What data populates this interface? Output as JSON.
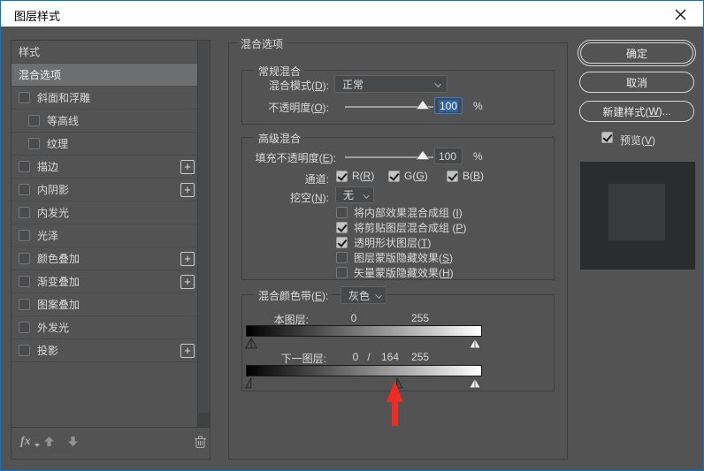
{
  "window": {
    "title": "图层样式",
    "close_glyph": "×",
    "accent_color": "#0078d7",
    "bg_color": "#535353",
    "titlebar_color": "#ffffff"
  },
  "sidebar": {
    "items": [
      {
        "label": "样式",
        "type": "plain",
        "selected": false
      },
      {
        "label": "混合选项",
        "type": "plain",
        "selected": true
      },
      {
        "label": "斜面和浮雕",
        "type": "check",
        "checked": false
      },
      {
        "label": "等高线",
        "type": "check",
        "checked": false,
        "indent": true
      },
      {
        "label": "纹理",
        "type": "check",
        "checked": false,
        "indent": true
      },
      {
        "label": "描边",
        "type": "check",
        "checked": false,
        "plus": true
      },
      {
        "label": "内阴影",
        "type": "check",
        "checked": false,
        "plus": true
      },
      {
        "label": "内发光",
        "type": "check",
        "checked": false
      },
      {
        "label": "光泽",
        "type": "check",
        "checked": false
      },
      {
        "label": "颜色叠加",
        "type": "check",
        "checked": false,
        "plus": true
      },
      {
        "label": "渐变叠加",
        "type": "check",
        "checked": false,
        "plus": true
      },
      {
        "label": "图案叠加",
        "type": "check",
        "checked": false
      },
      {
        "label": "外发光",
        "type": "check",
        "checked": false
      },
      {
        "label": "投影",
        "type": "check",
        "checked": false,
        "plus": true
      }
    ],
    "footer": {
      "fx_label": "fx"
    }
  },
  "panel": {
    "title": "混合选项",
    "general": {
      "title": "常规混合",
      "blend_mode_label": "混合模式(D):",
      "blend_mode_value": "正常",
      "opacity_label": "不透明度(O):",
      "opacity_value": "100",
      "opacity_unit": "%"
    },
    "advanced": {
      "title": "高级混合",
      "fill_label": "填充不透明度(E):",
      "fill_value": "100",
      "fill_unit": "%",
      "channels_label": "通道:",
      "channels": [
        {
          "label": "R(R)",
          "checked": true
        },
        {
          "label": "G(G)",
          "checked": true
        },
        {
          "label": "B(B)",
          "checked": true
        }
      ],
      "knockout_label": "挖空(N):",
      "knockout_value": "无",
      "options": [
        {
          "label": "将内部效果混合成组 (I)",
          "checked": false
        },
        {
          "label": "将剪贴图层混合成组 (P)",
          "checked": true
        },
        {
          "label": "透明形状图层(T)",
          "checked": true
        },
        {
          "label": "图层蒙版隐藏效果(S)",
          "checked": false
        },
        {
          "label": "矢量蒙版隐藏效果(H)",
          "checked": false
        }
      ]
    },
    "blend_if": {
      "title": "混合颜色带(E):",
      "value": "灰色",
      "this_label": "本图层:",
      "this_black": "0",
      "this_white": "255",
      "next_label": "下一图层:",
      "next_black_left": "0",
      "next_slash": "/",
      "next_black_right": "164",
      "next_white": "255"
    }
  },
  "actions": {
    "ok": "确定",
    "cancel": "取消",
    "new_style": "新建样式(W)...",
    "preview_label": "预览(V)",
    "preview_checked": true
  },
  "annotation": {
    "arrow_color": "#ee2c24",
    "arrow_direction": "up"
  }
}
